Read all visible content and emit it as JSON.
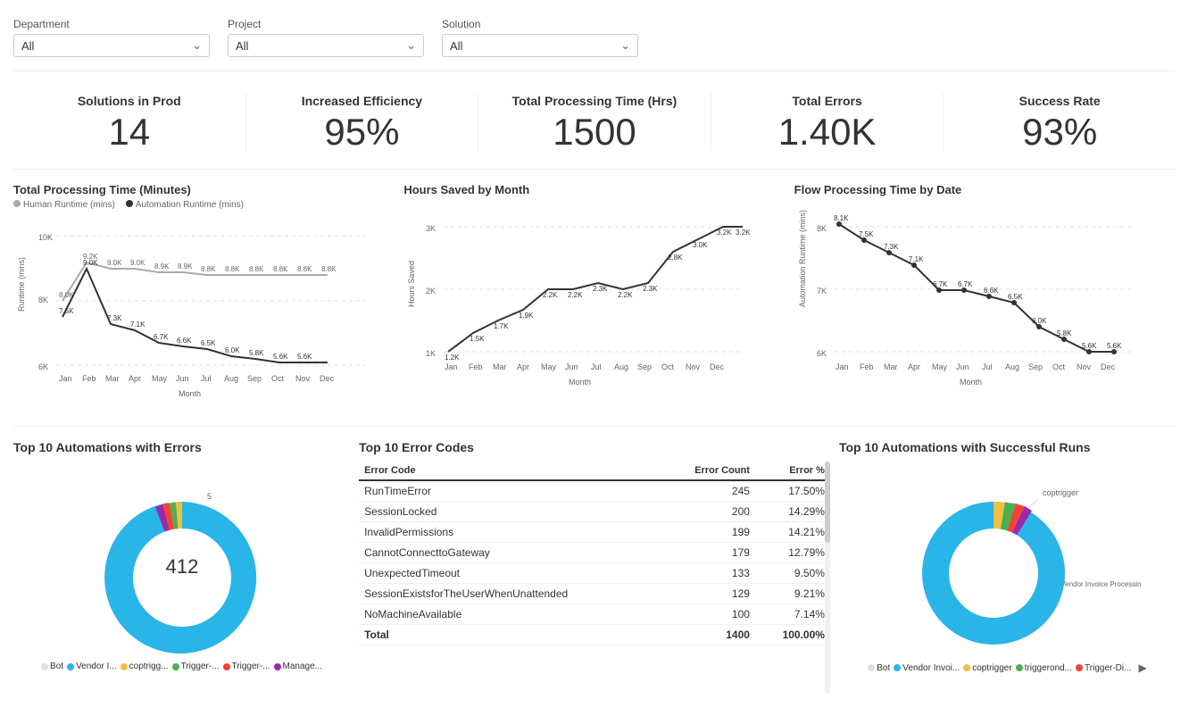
{
  "filters": {
    "department": {
      "label": "Department",
      "value": "All"
    },
    "project": {
      "label": "Project",
      "value": "All"
    },
    "solution": {
      "label": "Solution",
      "value": "All"
    }
  },
  "kpis": [
    {
      "title": "Solutions in Prod",
      "value": "14"
    },
    {
      "title": "Increased Efficiency",
      "value": "95%"
    },
    {
      "title": "Total Processing Time (Hrs)",
      "value": "1500"
    },
    {
      "title": "Total Errors",
      "value": "1.40K"
    },
    {
      "title": "Success Rate",
      "value": "93%"
    }
  ],
  "charts": {
    "processing_time": {
      "title": "Total Processing Time (Minutes)",
      "legend": [
        {
          "label": "Human Runtime (mins)",
          "color": "#aaa"
        },
        {
          "label": "Automation Runtime (mins)",
          "color": "#333"
        }
      ]
    },
    "hours_saved": {
      "title": "Hours Saved by Month"
    },
    "flow_processing": {
      "title": "Flow Processing Time by Date"
    }
  },
  "top_errors": {
    "title": "Top 10 Automations with Errors",
    "legend": [
      {
        "label": "Bot",
        "color": "#e0e0e0"
      },
      {
        "label": "Vendor I...",
        "color": "#29b5e8"
      },
      {
        "label": "coptrigg...",
        "color": "#f0c040"
      },
      {
        "label": "Trigger-...",
        "color": "#4caf50"
      },
      {
        "label": "Trigger-...",
        "color": "#f44336"
      },
      {
        "label": "Manage...",
        "color": "#9c27b0"
      }
    ],
    "center_label": "412",
    "top_label": "5"
  },
  "error_codes": {
    "title": "Top 10 Error Codes",
    "columns": [
      "Error Code",
      "Error Count",
      "Error %"
    ],
    "rows": [
      {
        "code": "RunTimeError",
        "count": "245",
        "pct": "17.50%"
      },
      {
        "code": "SessionLocked",
        "count": "200",
        "pct": "14.29%"
      },
      {
        "code": "InvalidPermissions",
        "count": "199",
        "pct": "14.21%"
      },
      {
        "code": "CannotConnecttoGateway",
        "count": "179",
        "pct": "12.79%"
      },
      {
        "code": "UnexpectedTimeout",
        "count": "133",
        "pct": "9.50%"
      },
      {
        "code": "SessionExistsforTheUserWhenUnattended",
        "count": "129",
        "pct": "9.21%"
      },
      {
        "code": "NoMachineAvailable",
        "count": "100",
        "pct": "7.14%"
      }
    ],
    "total_row": {
      "code": "Total",
      "count": "1400",
      "pct": "100.00%"
    }
  },
  "top_success": {
    "title": "Top 10 Automations with Successful Runs",
    "legend": [
      {
        "label": "Bot",
        "color": "#e0e0e0"
      },
      {
        "label": "Vendor Invoi...",
        "color": "#29b5e8"
      },
      {
        "label": "coptrigger",
        "color": "#f0c040"
      },
      {
        "label": "triggerond...",
        "color": "#4caf50"
      },
      {
        "label": "Trigger-Di...",
        "color": "#f44336"
      }
    ],
    "top_label": "coptrigger",
    "side_label": "Vendor Invoice Processing Cl..."
  }
}
